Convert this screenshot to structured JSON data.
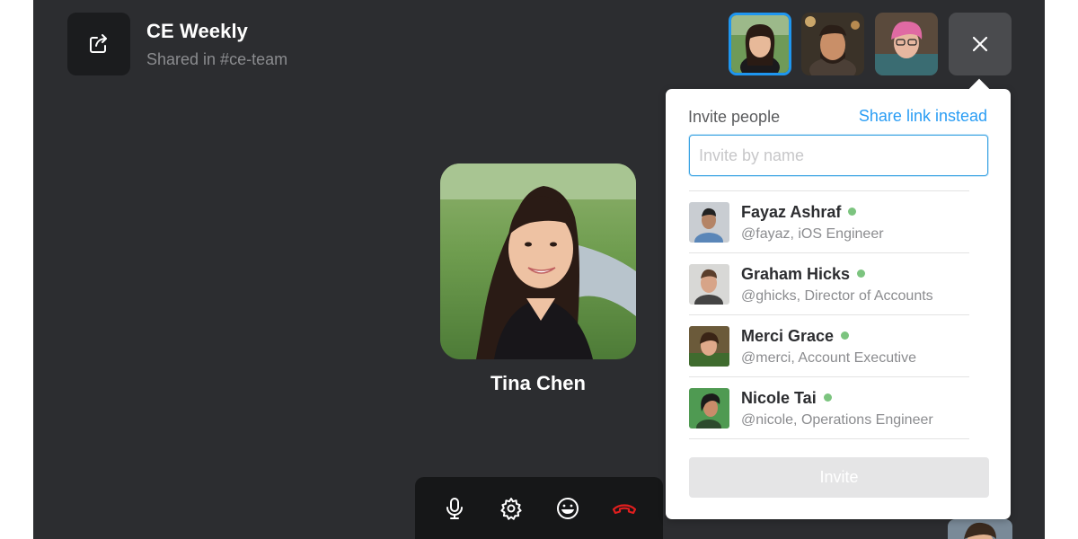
{
  "call": {
    "title": "CE Weekly",
    "subtitle": "Shared in #ce-team"
  },
  "header": {
    "share_icon": "share-icon",
    "close_icon": "close-icon",
    "participants": [
      {
        "name": "participant-1",
        "active": true
      },
      {
        "name": "participant-2",
        "active": false
      },
      {
        "name": "participant-3",
        "active": false
      }
    ]
  },
  "speaker": {
    "name": "Tina Chen"
  },
  "controls": [
    {
      "icon": "microphone-icon"
    },
    {
      "icon": "gear-icon"
    },
    {
      "icon": "emoji-icon"
    },
    {
      "icon": "hang-up-icon",
      "color": "#e01e1e"
    }
  ],
  "invite": {
    "heading": "Invite people",
    "share_link": "Share link instead",
    "input_value": "",
    "input_placeholder": "Invite by name",
    "button_label": "Invite",
    "people": [
      {
        "name": "Fayaz Ashraf",
        "handle": "@fayaz, iOS Engineer",
        "online": true
      },
      {
        "name": "Graham Hicks",
        "handle": "@ghicks, Director of Accounts",
        "online": true
      },
      {
        "name": "Merci Grace",
        "handle": "@merci, Account Executive",
        "online": true
      },
      {
        "name": "Nicole Tai",
        "handle": "@nicole, Operations Engineer",
        "online": true
      }
    ]
  },
  "colors": {
    "background": "#2c2d30",
    "accent": "#1e96f0",
    "link": "#2a9df4",
    "online": "#7cc47f",
    "hang_up": "#e01e1e"
  }
}
